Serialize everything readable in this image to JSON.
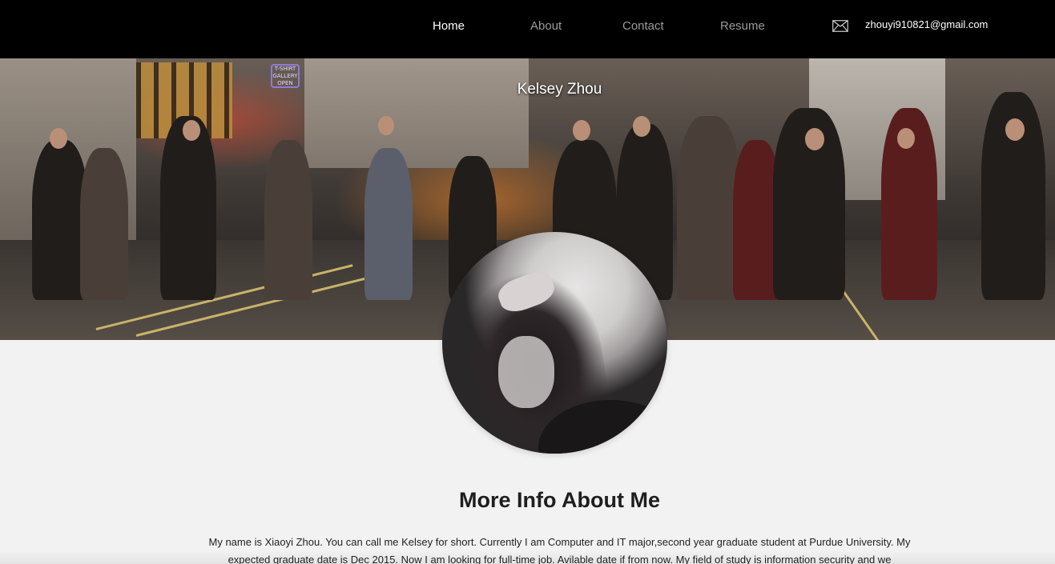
{
  "nav": {
    "items": [
      {
        "label": "Home",
        "active": true
      },
      {
        "label": "About",
        "active": false
      },
      {
        "label": "Contact",
        "active": false
      },
      {
        "label": "Resume",
        "active": false
      }
    ],
    "email": "zhouyi910821@gmail.com",
    "email_icon": "envelope-icon"
  },
  "hero": {
    "subtitle": "Kelsey Zhou",
    "sign_text": "T-SHIRT GALLERY OPEN"
  },
  "about": {
    "heading": "More Info About Me",
    "bio": "My name is Xiaoyi Zhou. You can call me Kelsey for short. Currently I am Computer and IT major,second year graduate student at Purdue University. My expected graduate date is Dec 2015. Now I am looking for full-time job. Avilable date if from now. My field of study is information security and we"
  },
  "colors": {
    "navbar_bg": "#000000",
    "nav_active": "#ffffff",
    "nav_inactive": "#9b9b9b",
    "page_bg": "#f2f2f2",
    "heading_text": "#1e1e1e"
  }
}
